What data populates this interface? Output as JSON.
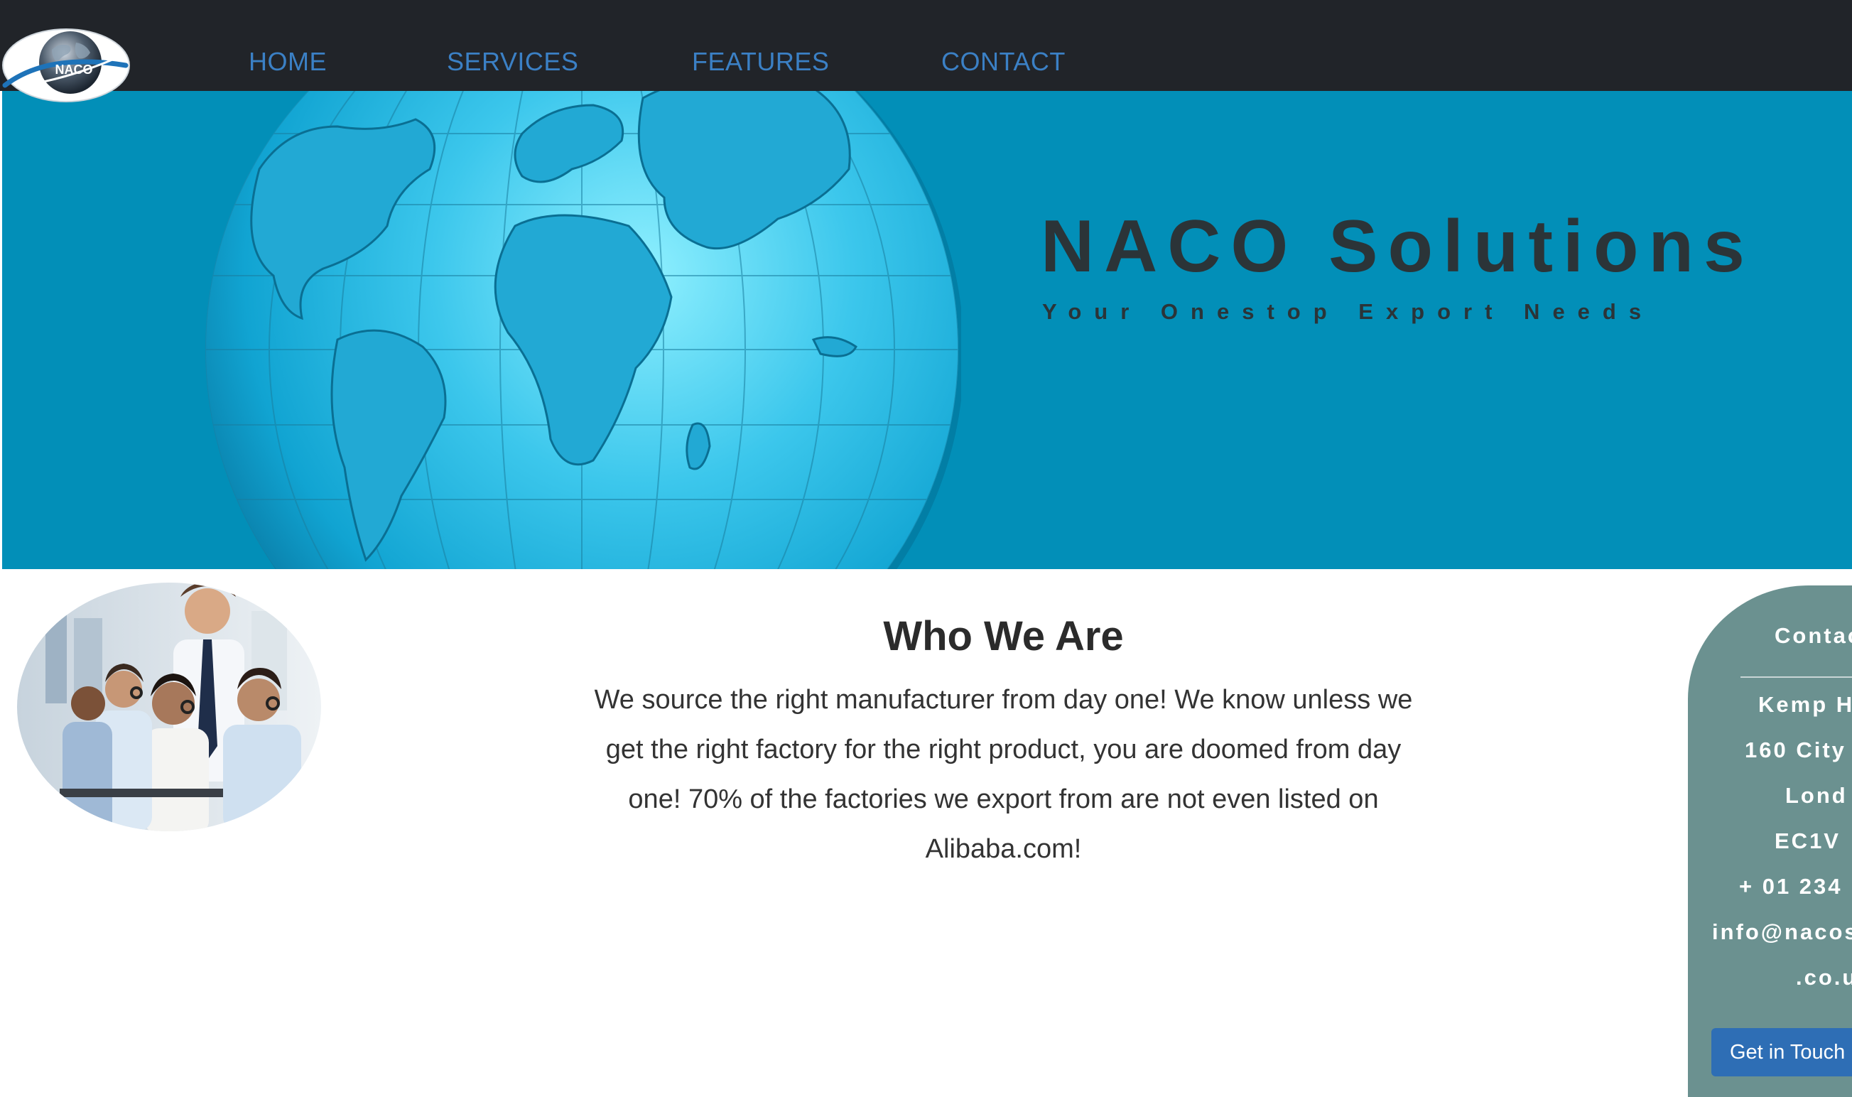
{
  "header": {
    "logo_text": "NACO",
    "nav": [
      {
        "label": "HOME"
      },
      {
        "label": "SERVICES"
      },
      {
        "label": "FEATURES"
      },
      {
        "label": "CONTACT"
      }
    ]
  },
  "hero": {
    "title": "NACO Solutions",
    "subtitle": "Your Onestop Export Needs"
  },
  "about": {
    "title": "Who We Are",
    "text": "We source the right manufacturer from day one! We know unless we get the right factory for the right product, you are doomed from day one! 70% of the factories we export from are not even listed on Alibaba.com!"
  },
  "contact": {
    "heading": "Contac",
    "lines": [
      "Kemp H",
      "160 City",
      "Lond",
      "EC1V",
      "+ 01 234",
      "info@nacos",
      ".co.u"
    ],
    "button_label": "Get in Touch"
  },
  "colors": {
    "navbar_bg": "#212429",
    "nav_link": "#3b80c5",
    "hero_bg": "#028fb8",
    "hero_text": "#2b3438",
    "contact_card_bg": "#6b9190",
    "button_bg": "#2e6eb5"
  }
}
